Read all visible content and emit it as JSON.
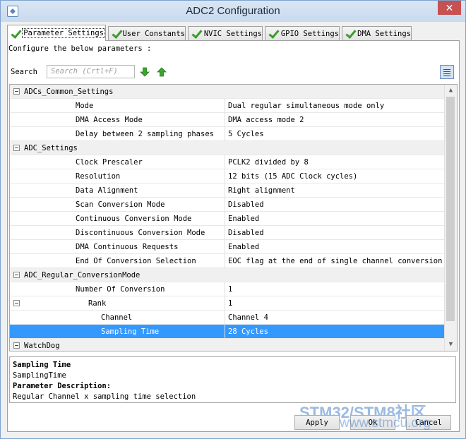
{
  "window": {
    "title": "ADC2 Configuration",
    "close_glyph": "✕"
  },
  "tabs": [
    {
      "label": "Parameter Settings",
      "active": true
    },
    {
      "label": "User Constants",
      "active": false
    },
    {
      "label": "NVIC Settings",
      "active": false
    },
    {
      "label": "GPIO Settings",
      "active": false
    },
    {
      "label": "DMA Settings",
      "active": false
    }
  ],
  "intro_text": "Configure the below parameters :",
  "search": {
    "label": "Search",
    "placeholder": "Search (Crtl+F)"
  },
  "icons": {
    "down": "arrow-down-icon",
    "up": "arrow-up-icon",
    "view": "list-view-icon"
  },
  "params": {
    "rows": [
      {
        "type": "category",
        "name": "ADCs_Common_Settings"
      },
      {
        "type": "param",
        "name": "Mode",
        "value": "Dual regular simultaneous mode only"
      },
      {
        "type": "param",
        "name": "DMA Access Mode",
        "value": "DMA access mode 2"
      },
      {
        "type": "param",
        "name": "Delay between 2 sampling phases",
        "value": "5 Cycles"
      },
      {
        "type": "category",
        "name": "ADC_Settings"
      },
      {
        "type": "param",
        "name": "Clock Prescaler",
        "value": "PCLK2 divided by 8"
      },
      {
        "type": "param",
        "name": "Resolution",
        "value": "12 bits (15 ADC Clock cycles)"
      },
      {
        "type": "param",
        "name": "Data Alignment",
        "value": "Right alignment"
      },
      {
        "type": "param",
        "name": "Scan Conversion Mode",
        "value": "Disabled"
      },
      {
        "type": "param",
        "name": "Continuous Conversion Mode",
        "value": "Enabled"
      },
      {
        "type": "param",
        "name": "Discontinuous Conversion Mode",
        "value": "Disabled"
      },
      {
        "type": "param",
        "name": "DMA Continuous Requests",
        "value": "Enabled"
      },
      {
        "type": "param",
        "name": "End Of Conversion Selection",
        "value": "EOC flag at the end of single channel conversion"
      },
      {
        "type": "category",
        "name": "ADC_Regular_ConversionMode"
      },
      {
        "type": "param",
        "name": "Number Of Conversion",
        "value": "1"
      },
      {
        "type": "group",
        "name": "Rank",
        "value": "1"
      },
      {
        "type": "subparam",
        "name": "Channel",
        "value": "Channel 4"
      },
      {
        "type": "subparam",
        "name": "Sampling Time",
        "value": "28 Cycles",
        "selected": true
      },
      {
        "type": "category",
        "name": "WatchDog"
      }
    ]
  },
  "description": {
    "heading": "Sampling Time",
    "param_id": "SamplingTime",
    "desc_heading": "Parameter Description:",
    "desc_text": "Regular Channel x sampling time selection"
  },
  "buttons": {
    "apply": "Apply",
    "ok": "Ok",
    "cancel": "Cancel"
  },
  "watermark": {
    "line1": "STM32/STM8社区",
    "line2": "www.stmcu.org"
  }
}
